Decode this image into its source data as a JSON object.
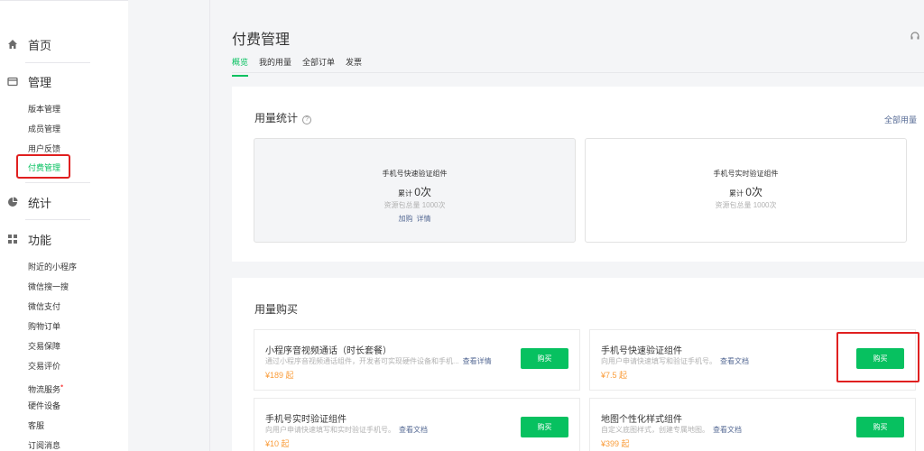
{
  "sidebar": {
    "home": "首页",
    "manage": {
      "title": "管理",
      "items": [
        "版本管理",
        "成员管理",
        "用户反馈",
        "付费管理"
      ]
    },
    "stats": "统计",
    "features": {
      "title": "功能",
      "items": [
        "附近的小程序",
        "微信搜一搜",
        "微信支付",
        "购物订单",
        "交易保障",
        "交易评价",
        "物流服务",
        "硬件设备",
        "客服",
        "订阅消息"
      ]
    },
    "red_dot": "•"
  },
  "page": {
    "title": "付费管理",
    "help_icon": "?",
    "tabs": [
      "概览",
      "我的用量",
      "全部订单",
      "发票"
    ]
  },
  "usage_stats": {
    "title": "用量统计",
    "help": "?",
    "all_usage_link": "全部用量",
    "cards": [
      {
        "name": "手机号快速验证组件",
        "count_label": "累计",
        "count": "0次",
        "total": "资源包总量 1000次",
        "link1": "加购",
        "link2": "详情"
      },
      {
        "name": "手机号实时验证组件",
        "count_label": "累计",
        "count": "0次",
        "total": "资源包总量 1000次"
      }
    ]
  },
  "purchase": {
    "title": "用量购买",
    "products": [
      {
        "name": "小程序音视频通话（时长套餐）",
        "desc": "通过小程序音视频通话组件，开发者可实现硬件设备和手机...",
        "link": "查看详情",
        "price": "¥189 起",
        "buy": "购买"
      },
      {
        "name": "手机号快速验证组件",
        "desc": "向用户申请快速填写和验证手机号。",
        "link": "查看文档",
        "price": "¥7.5 起",
        "buy": "购买"
      },
      {
        "name": "手机号实时验证组件",
        "desc": "向用户申请快速填写和实时验证手机号。",
        "link": "查看文档",
        "price": "¥10 起",
        "buy": "购买"
      },
      {
        "name": "地图个性化样式组件",
        "desc": "自定义底图样式，创建专属地图。",
        "link": "查看文档",
        "price": "¥399 起",
        "buy": "购买"
      }
    ]
  }
}
